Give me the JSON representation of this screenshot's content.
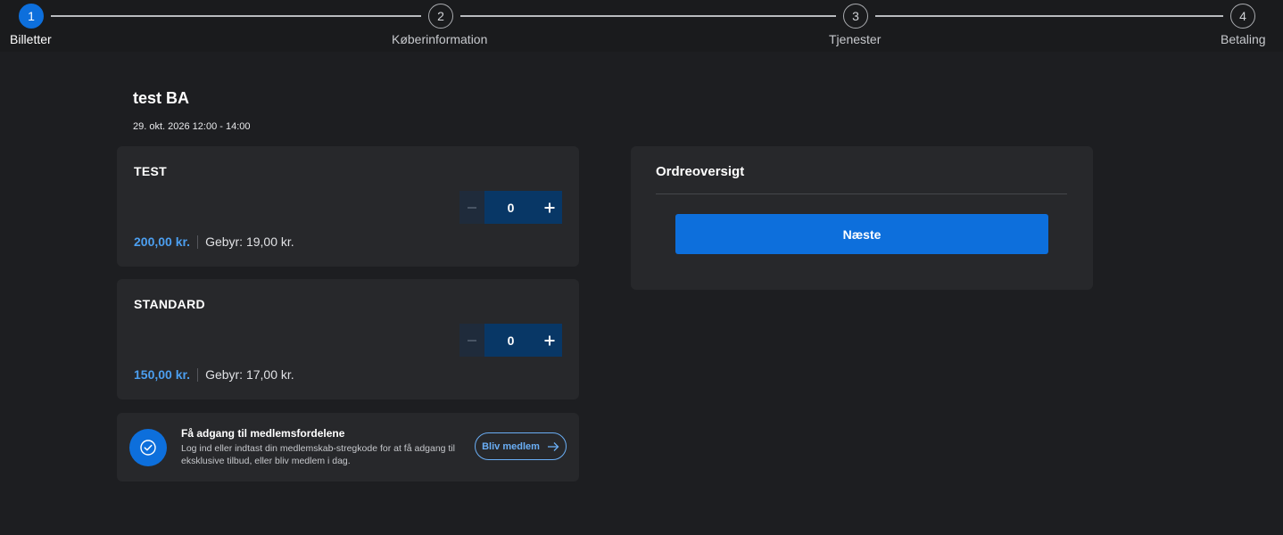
{
  "stepper": {
    "steps": [
      {
        "number": "1",
        "label": "Billetter",
        "active": true
      },
      {
        "number": "2",
        "label": "Køberinformation",
        "active": false
      },
      {
        "number": "3",
        "label": "Tjenester",
        "active": false
      },
      {
        "number": "4",
        "label": "Betaling",
        "active": false
      }
    ]
  },
  "event": {
    "title": "test BA",
    "date": "29. okt. 2026 12:00 - 14:00"
  },
  "tickets": [
    {
      "name": "TEST",
      "quantity": "0",
      "price": "200,00 kr.",
      "fee": "Gebyr: 19,00 kr.",
      "minus_icon": "minus-icon",
      "plus_icon": "plus-icon"
    },
    {
      "name": "STANDARD",
      "quantity": "0",
      "price": "150,00 kr.",
      "fee": "Gebyr: 17,00 kr.",
      "minus_icon": "minus-icon",
      "plus_icon": "plus-icon"
    }
  ],
  "membership": {
    "icon": "check-circle-icon",
    "title": "Få adgang til medlemsfordelene",
    "text": "Log ind eller indtast din medlemskab-stregkode for at få adgang til eksklusive tilbud, eller bliv medlem i dag.",
    "button_label": "Bliv medlem",
    "button_icon": "arrow-right-icon"
  },
  "order": {
    "title": "Ordreoversigt",
    "next_label": "Næste"
  },
  "colors": {
    "background": "#1d1e21",
    "card": "#27282b",
    "accent": "#0d6fdc",
    "price": "#4c9ff0"
  }
}
